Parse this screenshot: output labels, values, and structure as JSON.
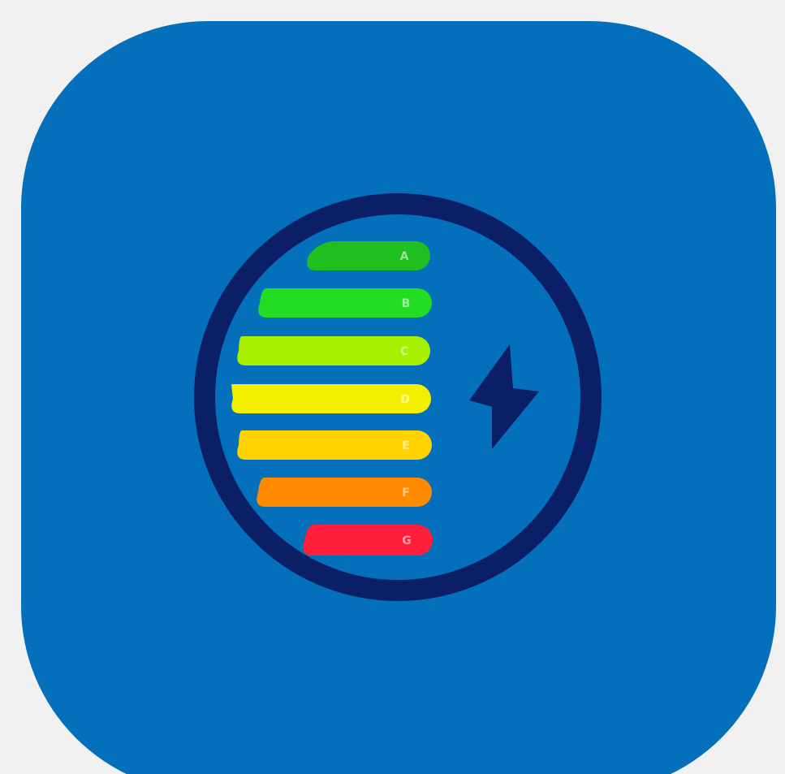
{
  "icon": {
    "name": "energy-efficiency-app-icon",
    "tile_color": "#0470bc",
    "ring_color": "#0b1f66",
    "bolt_color": "#0b1f66",
    "page_background": "#f1f1f1"
  },
  "rating_bars": [
    {
      "grade": "A",
      "color": "#1fbf1f"
    },
    {
      "grade": "B",
      "color": "#22dd22"
    },
    {
      "grade": "C",
      "color": "#a8f000"
    },
    {
      "grade": "D",
      "color": "#f2f000"
    },
    {
      "grade": "E",
      "color": "#ffd200"
    },
    {
      "grade": "F",
      "color": "#ff8a00"
    },
    {
      "grade": "G",
      "color": "#ff1f3a"
    }
  ]
}
